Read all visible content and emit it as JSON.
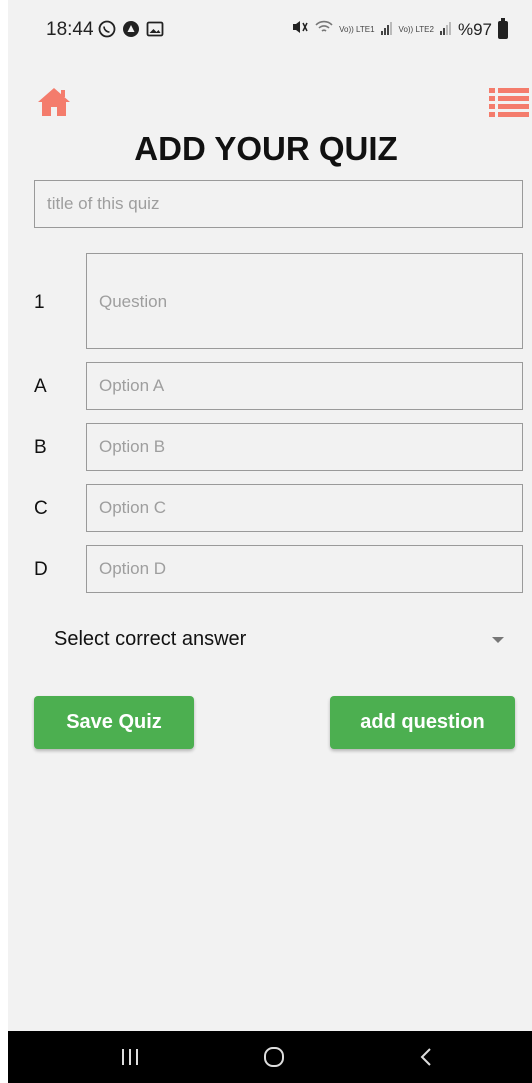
{
  "status_bar": {
    "time": "18:44",
    "battery": "%97",
    "icons_left": [
      "whatsapp-icon",
      "app-icon",
      "gallery-icon"
    ],
    "icons_right": [
      "mute-icon",
      "wifi-icon",
      "volte-lte1-signal-icon",
      "volte-lte2-signal-icon",
      "battery-icon"
    ],
    "net1": "Vo)) LTE1",
    "net2": "Vo)) LTE2"
  },
  "header": {
    "title": "ADD YOUR QUIZ",
    "home_icon": "home-icon",
    "menu_icon": "list-menu-icon",
    "accent_color": "#f47c6c"
  },
  "form": {
    "title_placeholder": "title of this quiz",
    "question_number": "1",
    "question_placeholder": "Question",
    "options": [
      {
        "label": "A",
        "placeholder": "Option A"
      },
      {
        "label": "B",
        "placeholder": "Option B"
      },
      {
        "label": "C",
        "placeholder": "Option C"
      },
      {
        "label": "D",
        "placeholder": "Option D"
      }
    ],
    "select_label": "Select correct answer"
  },
  "buttons": {
    "save": "Save Quiz",
    "add_question": "add question",
    "color": "#4caf50"
  },
  "nav_bar": {
    "icons": [
      "recents-icon",
      "home-circle-icon",
      "back-icon"
    ]
  }
}
